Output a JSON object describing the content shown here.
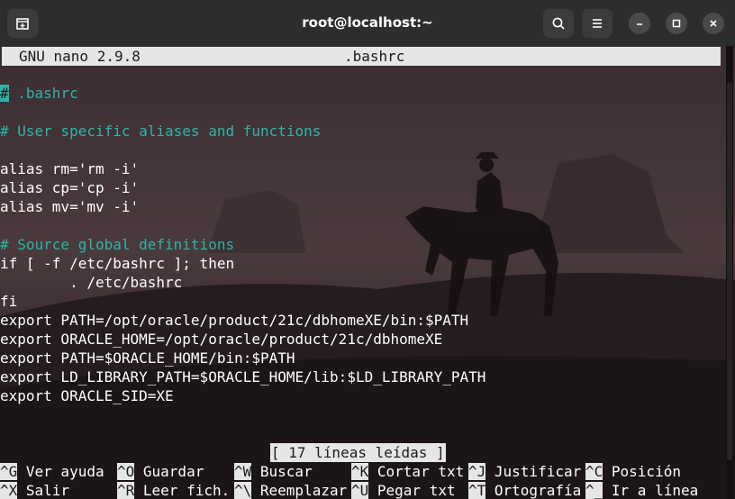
{
  "window": {
    "title": "root@localhost:~"
  },
  "editor": {
    "app_version": "GNU nano 2.9.8",
    "filename": ".bashrc",
    "lines": [
      {
        "text": " .bashrc",
        "kind": "comment",
        "cursor_char": "#"
      },
      {
        "text": "",
        "kind": "blank"
      },
      {
        "text": "# User specific aliases and functions",
        "kind": "comment"
      },
      {
        "text": "",
        "kind": "blank"
      },
      {
        "text": "alias rm='rm -i'",
        "kind": "code"
      },
      {
        "text": "alias cp='cp -i'",
        "kind": "code"
      },
      {
        "text": "alias mv='mv -i'",
        "kind": "code"
      },
      {
        "text": "",
        "kind": "blank"
      },
      {
        "text": "# Source global definitions",
        "kind": "comment"
      },
      {
        "text": "if [ -f /etc/bashrc ]; then",
        "kind": "code"
      },
      {
        "text": "        . /etc/bashrc",
        "kind": "code"
      },
      {
        "text": "fi",
        "kind": "code"
      },
      {
        "text": "export PATH=/opt/oracle/product/21c/dbhomeXE/bin:$PATH",
        "kind": "code"
      },
      {
        "text": "export ORACLE_HOME=/opt/oracle/product/21c/dbhomeXE",
        "kind": "code"
      },
      {
        "text": "export PATH=$ORACLE_HOME/bin:$PATH",
        "kind": "code"
      },
      {
        "text": "export LD_LIBRARY_PATH=$ORACLE_HOME/lib:$LD_LIBRARY_PATH",
        "kind": "code"
      },
      {
        "text": "export ORACLE_SID=XE",
        "kind": "code"
      }
    ],
    "status_message": "[ 17 líneas leídas ]"
  },
  "shortcuts": {
    "row1": [
      {
        "key": "^G",
        "label": " Ver ayuda"
      },
      {
        "key": "^O",
        "label": " Guardar"
      },
      {
        "key": "^W",
        "label": " Buscar"
      },
      {
        "key": "^K",
        "label": " Cortar txt"
      },
      {
        "key": "^J",
        "label": " Justificar"
      },
      {
        "key": "^C",
        "label": " Posición"
      }
    ],
    "row2": [
      {
        "key": "^X",
        "label": " Salir"
      },
      {
        "key": "^R",
        "label": " Leer fich."
      },
      {
        "key": "^\\",
        "label": " Reemplazar"
      },
      {
        "key": "^U",
        "label": " Pegar txt"
      },
      {
        "key": "^T",
        "label": " Ortografía"
      },
      {
        "key": "^_",
        "label": " Ir a línea"
      }
    ]
  },
  "icons": {
    "new_tab": "new-tab-icon",
    "search": "search-icon",
    "menu": "hamburger-menu-icon",
    "minimize": "minimize-icon",
    "maximize": "maximize-icon",
    "close": "close-icon"
  },
  "colors": {
    "comment": "#2eb5aa",
    "titlebar": "#2d2d2d",
    "inverse_bar": "#e6e6e6"
  }
}
